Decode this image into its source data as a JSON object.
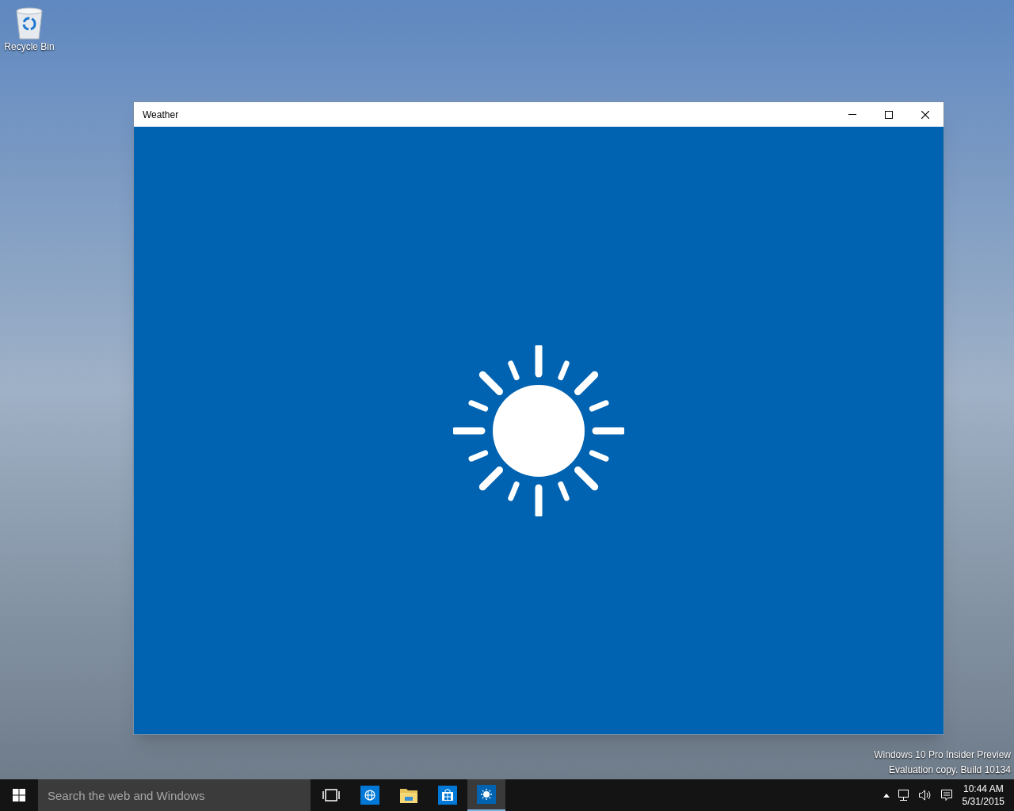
{
  "desktop": {
    "icons": [
      {
        "label": "Recycle Bin"
      }
    ],
    "watermark": [
      "Windows 10 Pro Insider Preview",
      "Evaluation copy. Build 10134"
    ]
  },
  "window": {
    "title": "Weather"
  },
  "taskbar": {
    "search": {
      "placeholder": "Search the web and Windows"
    },
    "apps": [
      {
        "kind": "taskview",
        "selected": false
      },
      {
        "kind": "browser",
        "selected": false
      },
      {
        "kind": "folder",
        "selected": false
      },
      {
        "kind": "store",
        "selected": false
      },
      {
        "kind": "weather",
        "selected": true
      }
    ],
    "clock": {
      "time": "10:44 AM",
      "date": "5/31/2015"
    }
  }
}
